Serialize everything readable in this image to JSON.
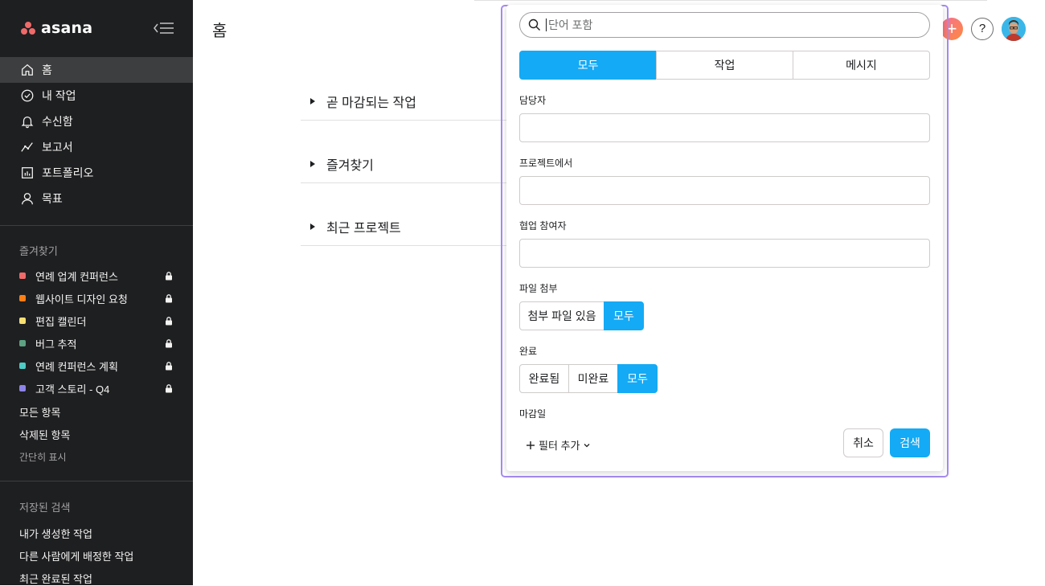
{
  "app": {
    "logo_text": "asana"
  },
  "sidebar": {
    "nav": [
      {
        "label": "홈",
        "icon": "home-icon",
        "active": true
      },
      {
        "label": "내 작업",
        "icon": "check-circle-icon"
      },
      {
        "label": "수신함",
        "icon": "bell-icon"
      },
      {
        "label": "보고서",
        "icon": "line-chart-icon"
      },
      {
        "label": "포트폴리오",
        "icon": "bar-chart-icon"
      },
      {
        "label": "목표",
        "icon": "person-icon"
      }
    ],
    "favorites_title": "즐겨찾기",
    "favorites": [
      {
        "label": "연례 업계 컨퍼런스",
        "color": "#f06a6a"
      },
      {
        "label": "웹사이트 디자인 요청",
        "color": "#fd7e14"
      },
      {
        "label": "편집 캘린더",
        "color": "#f8df72"
      },
      {
        "label": "버그 추적",
        "color": "#5da283"
      },
      {
        "label": "연례 컨퍼런스 계획",
        "color": "#4ecbc4"
      },
      {
        "label": "고객 스토리 - Q4",
        "color": "#8d84e8"
      }
    ],
    "all_items": "모든 항목",
    "deleted_items": "삭제된 항목",
    "show_less": "간단히 표시",
    "saved_searches_title": "저장된 검색",
    "saved_searches": [
      "내가 생성한 작업",
      "다른 사람에게 배정한 작업",
      "최근 완료된 작업"
    ]
  },
  "main": {
    "title": "홈",
    "sections": [
      "곧 마감되는 작업",
      "즐겨찾기",
      "최근 프로젝트"
    ],
    "help_label": "?",
    "add_label": "+"
  },
  "search_panel": {
    "placeholder": "단어 포함",
    "type_tabs": [
      "모두",
      "작업",
      "메시지"
    ],
    "assignee_label": "담당자",
    "project_label": "프로젝트에서",
    "collaborators_label": "협업 참여자",
    "attachment_label": "파일 첨부",
    "attachment_options": [
      "첨부 파일 있음",
      "모두"
    ],
    "completion_label": "완료",
    "completion_options": [
      "완료됨",
      "미완료",
      "모두"
    ],
    "due_label": "마감일",
    "add_filter": "필터 추가",
    "cancel": "취소",
    "search": "검색",
    "accent": "#14aaf5"
  }
}
